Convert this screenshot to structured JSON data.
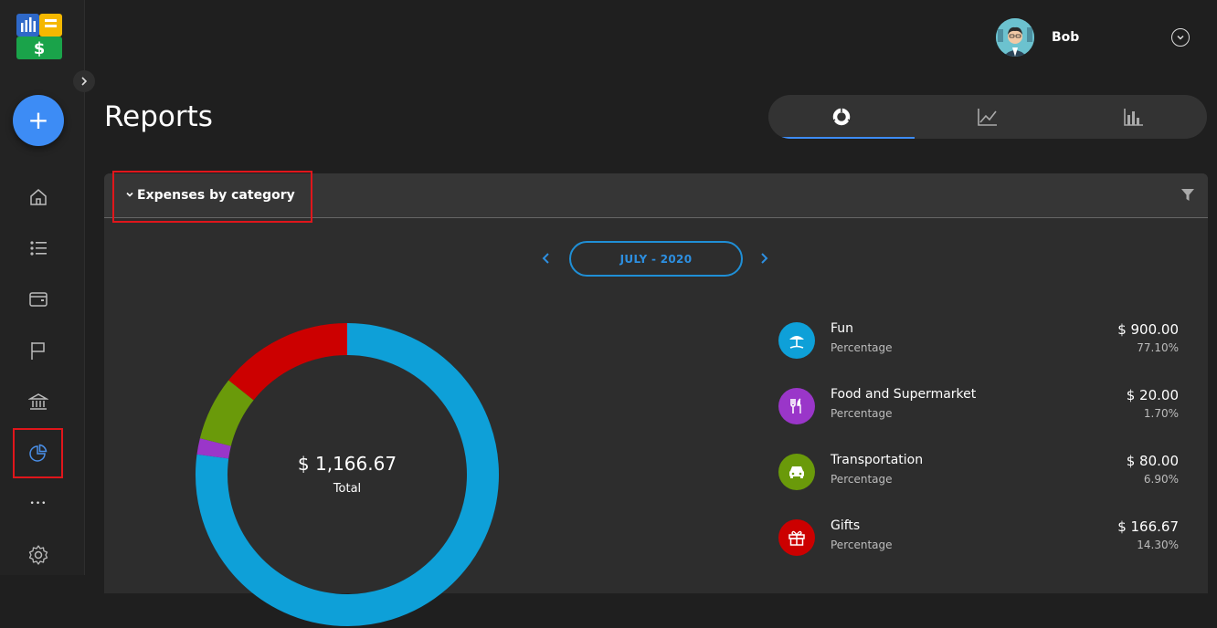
{
  "sidebar": {
    "add_label": "+",
    "more_label": "•••"
  },
  "user": {
    "name": "Bob"
  },
  "page": {
    "title": "Reports"
  },
  "panel": {
    "title": "Expenses by category",
    "month": "JULY - 2020"
  },
  "donut": {
    "total": "$ 1,166.67",
    "label": "Total"
  },
  "chart_data": {
    "type": "pie",
    "categories": [
      "Fun",
      "Food and Supermarket",
      "Transportation",
      "Gifts"
    ],
    "values": [
      900.0,
      20.0,
      80.0,
      166.67
    ],
    "colors": [
      "#0ea0d8",
      "#9a36c9",
      "#6a9a0a",
      "#cc0000"
    ]
  },
  "categories": [
    {
      "name": "Fun",
      "sub": "Percentage",
      "amount": "$ 900.00",
      "percent": "77.10%",
      "color": "#0ea0d8",
      "icon": "beach-umbrella-icon"
    },
    {
      "name": "Food and Supermarket",
      "sub": "Percentage",
      "amount": "$ 20.00",
      "percent": "1.70%",
      "color": "#9a36c9",
      "icon": "cutlery-icon"
    },
    {
      "name": "Transportation",
      "sub": "Percentage",
      "amount": "$ 80.00",
      "percent": "6.90%",
      "color": "#6a9a0a",
      "icon": "car-icon"
    },
    {
      "name": "Gifts",
      "sub": "Percentage",
      "amount": "$ 166.67",
      "percent": "14.30%",
      "color": "#cc0000",
      "icon": "gift-icon"
    }
  ],
  "colors": {
    "accent": "#3d8cf5",
    "month_blue": "#1f8fd6",
    "highlight": "#e0161b"
  }
}
